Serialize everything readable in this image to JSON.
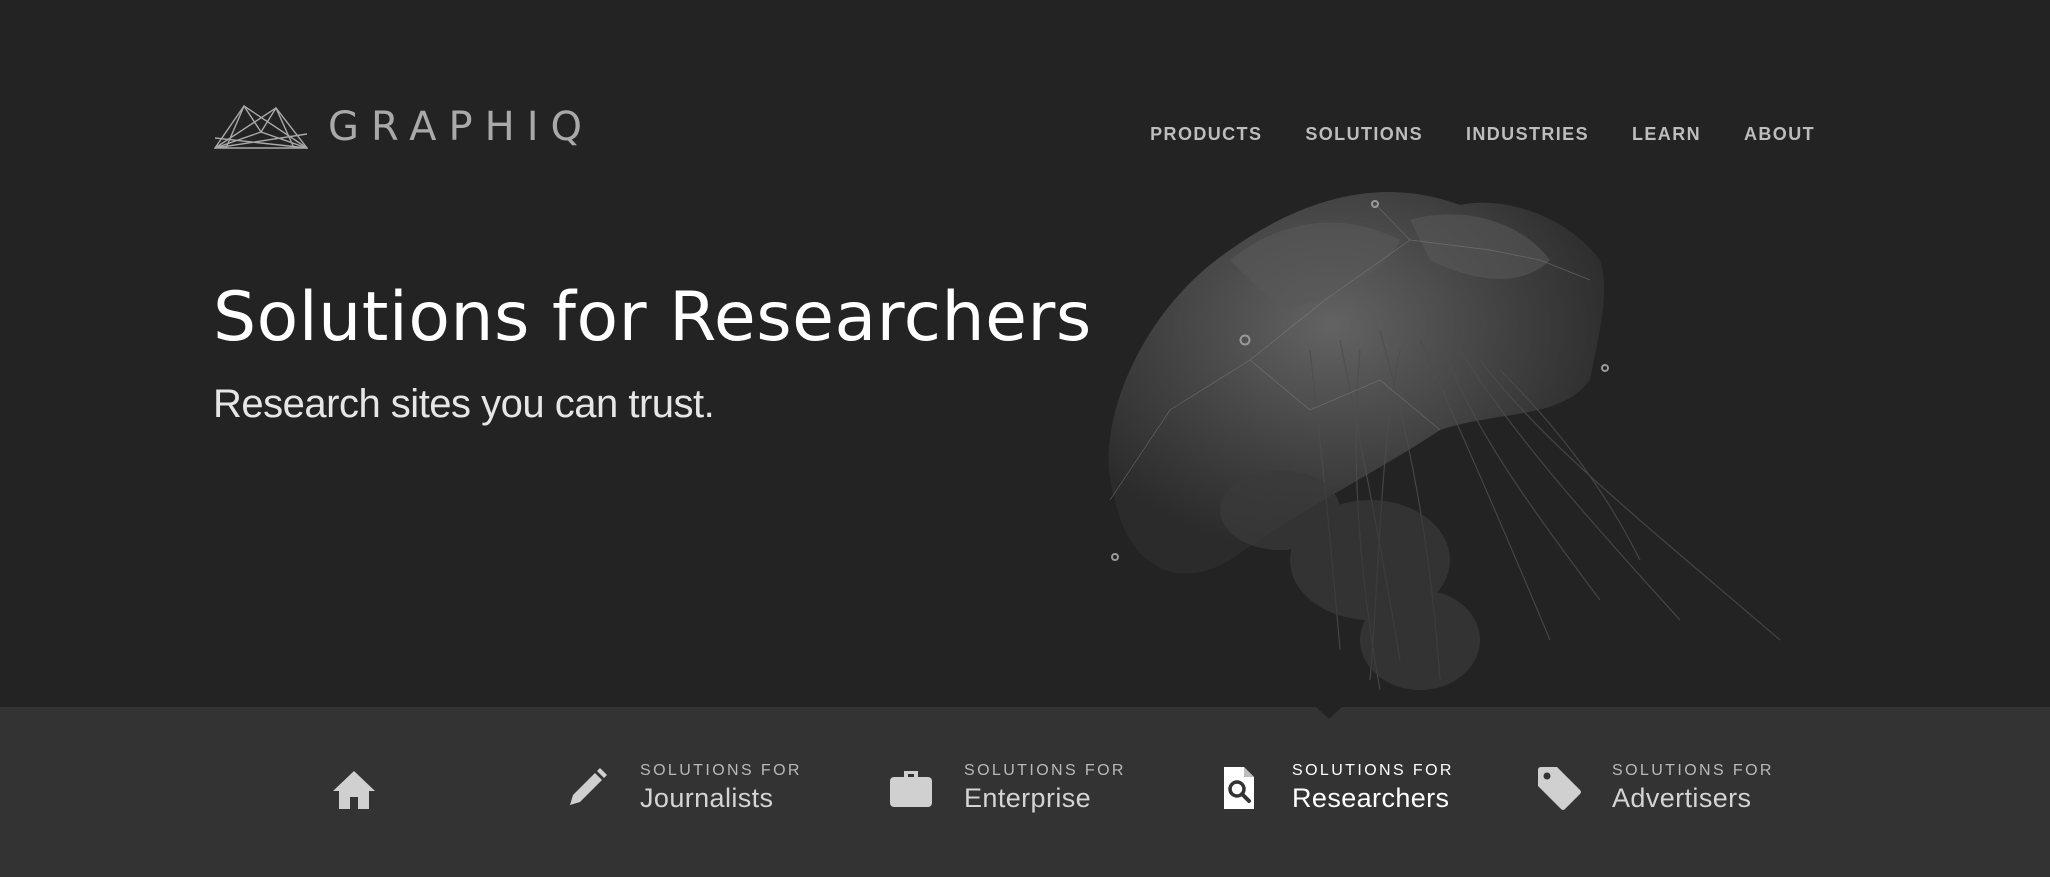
{
  "brand": {
    "name": "GRAPHIQ",
    "logo_icon": "mountain-lines-logo"
  },
  "nav": {
    "items": [
      {
        "label": "PRODUCTS"
      },
      {
        "label": "SOLUTIONS"
      },
      {
        "label": "INDUSTRIES"
      },
      {
        "label": "LEARN"
      },
      {
        "label": "ABOUT"
      }
    ]
  },
  "hero": {
    "title": "Solutions for Researchers",
    "subtitle": "Research sites you can trust.",
    "image": "jellyfish-photo"
  },
  "subnav": {
    "home_icon": "home-icon",
    "active_item": "Researchers",
    "items": [
      {
        "prefix": "SOLUTIONS FOR",
        "name": "Journalists",
        "icon": "pencil-icon"
      },
      {
        "prefix": "SOLUTIONS FOR",
        "name": "Enterprise",
        "icon": "briefcase-icon"
      },
      {
        "prefix": "SOLUTIONS FOR",
        "name": "Researchers",
        "icon": "document-search-icon"
      },
      {
        "prefix": "SOLUTIONS FOR",
        "name": "Advertisers",
        "icon": "tag-icon"
      }
    ]
  },
  "colors": {
    "hero_bg": "#232323",
    "subnav_bg": "#333333",
    "text_primary": "#ffffff",
    "text_muted": "#bdbdbd"
  }
}
